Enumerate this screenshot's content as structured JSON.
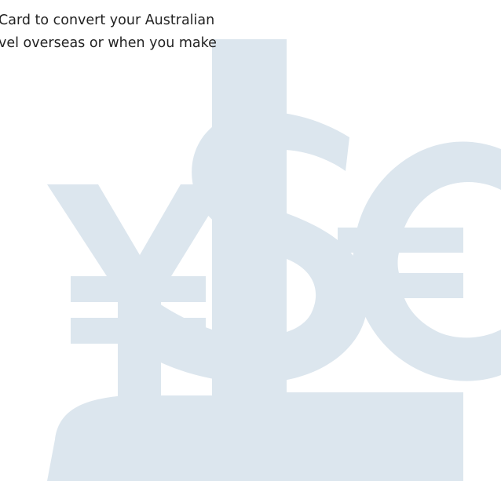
{
  "intro": {
    "line1": "Card to convert your Australian",
    "line2": "vel overseas or when you make"
  },
  "illustration": {
    "name": "currency-symbols-watermark",
    "symbols": [
      "¥",
      "$",
      "€"
    ],
    "color": "#DCE6EE"
  }
}
